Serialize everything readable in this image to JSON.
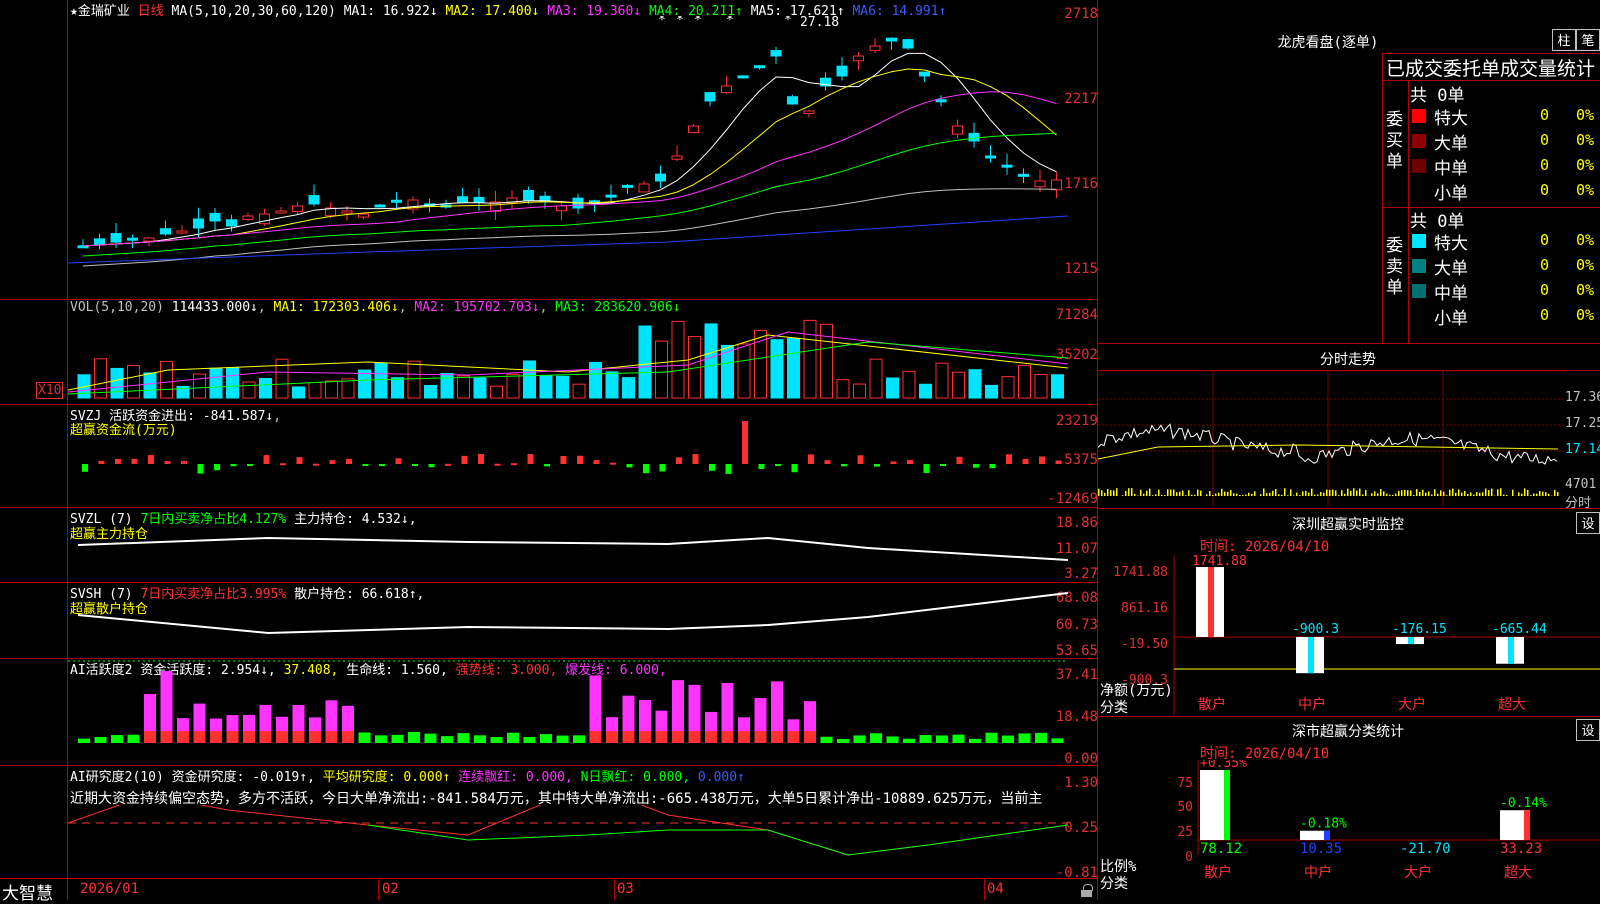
{
  "app": {
    "logo": "大智慧",
    "stock_name": "金瑞矿业",
    "period": "日线"
  },
  "kline": {
    "ma_header": "MA(5,10,20,30,60,120)",
    "ma1": "MA1: 16.922↓",
    "ma2": "MA2: 17.400↓",
    "ma3": "MA3: 19.360↓",
    "ma4": "MA4: 20.211↑",
    "ma5": "MA5: 17.621↑",
    "ma6": "MA6: 14.991↑",
    "y_labels": [
      "2718",
      "2217",
      "1716",
      "1215"
    ],
    "peak_label": "27.18",
    "stars": [
      "*",
      "*",
      "*",
      "*",
      "*"
    ]
  },
  "vol": {
    "header": "VOL(5,10,20)",
    "value": "114433.000↓",
    "ma1": "MA1: 172303.406↓",
    "ma2": "MA2: 195702.703↓",
    "ma3": "MA3: 283620.906↓",
    "y_labels": [
      "71284",
      "35202"
    ],
    "unit": "X10"
  },
  "svzj": {
    "header": "SVZJ",
    "title": "活跃资金进出: -841.587↓",
    "subtitle": "超赢资金流(万元)",
    "y_labels": [
      "23219",
      "5375",
      "-12469"
    ]
  },
  "svzl": {
    "header": "SVZL (7)",
    "desc": "7日内买卖净占比4.127%",
    "label": "主力持仓: 4.532↓,",
    "subtitle": "超赢主力持仓",
    "y_labels": [
      "18.86",
      "11.07",
      "3.27"
    ]
  },
  "svsh": {
    "header": "SVSH (7)",
    "desc": "7日内买卖净占比3.995%",
    "label": "散户持仓: 66.618↑,",
    "subtitle": "超赢散户持仓",
    "y_labels": [
      "68.08",
      "60.73",
      "53.65"
    ]
  },
  "ai1": {
    "header": "AI活跃度2",
    "a": "资金活跃度: 2.954↓,",
    "b": "37.408,",
    "c": "生命线: 1.560,",
    "d": "强势线: 3.000,",
    "e": "爆发线: 6.000,",
    "y_labels": [
      "37.41",
      "18.48",
      "0.00"
    ]
  },
  "ai2": {
    "header": "AI研究度2(10)",
    "a": "资金研究度: -0.019↑,",
    "b": "平均研究度: 0.000↑",
    "c": "连续飘红: 0.000,",
    "d": "N日飘红: 0.000,",
    "e": "0.000↑",
    "commentary": "近期大资金持续偏空态势，多方不活跃，今日大单净流出:-841.584万元，其中特大单净流出:-665.438万元，大单5日累计净出-10889.625万元，当前主",
    "y_labels": [
      "1.30",
      "0.25",
      "-0.81"
    ]
  },
  "xaxis": {
    "labels": [
      "2026/01",
      "02",
      "03",
      "04"
    ]
  },
  "dragon": {
    "title": "龙虎看盘(逐单)",
    "btn1": "柱",
    "btn2": "笔",
    "stats_title": "已成交委托单成交量统计",
    "buy_label": "委买单",
    "sell_label": "委卖单",
    "buy_total": "共 0单",
    "sell_total": "共 0单",
    "buy_rows": [
      {
        "name": "特大",
        "count": "0",
        "pct": "0%",
        "color": "#ff0000"
      },
      {
        "name": "大单",
        "count": "0",
        "pct": "0%",
        "color": "#900000"
      },
      {
        "name": "中单",
        "count": "0",
        "pct": "0%",
        "color": "#700000"
      },
      {
        "name": "小单",
        "count": "0",
        "pct": "0%",
        "color": ""
      }
    ],
    "sell_rows": [
      {
        "name": "特大",
        "count": "0",
        "pct": "0%",
        "color": "#00e5ff"
      },
      {
        "name": "大单",
        "count": "0",
        "pct": "0%",
        "color": "#008080"
      },
      {
        "name": "中单",
        "count": "0",
        "pct": "0%",
        "color": "#007070"
      },
      {
        "name": "小单",
        "count": "0",
        "pct": "0%",
        "color": ""
      }
    ]
  },
  "minute": {
    "title": "分时走势",
    "y_labels": [
      "17.36",
      "17.25",
      "17.14",
      "4701"
    ],
    "x_label": "分时"
  },
  "monitor": {
    "title": "深圳超赢实时监控",
    "btn": "设",
    "time": "时间: 2026/04/10",
    "y_labels": [
      "1741.88",
      "861.16",
      "-19.50",
      "-900.3"
    ],
    "axis_label": "净额(万元)",
    "cat_label": "分类",
    "bars": [
      {
        "cat": "散户",
        "value": 1741.88,
        "label": "1741.88"
      },
      {
        "cat": "中户",
        "value": -900.3,
        "label": "-900.3"
      },
      {
        "cat": "大户",
        "value": -176.15,
        "label": "-176.15"
      },
      {
        "cat": "超大",
        "value": -665.44,
        "label": "-665.44"
      }
    ]
  },
  "stats": {
    "title": "深市超赢分类统计",
    "btn": "设",
    "time": "时间: 2026/04/10",
    "y_labels": [
      "75",
      "50",
      "25",
      "0"
    ],
    "axis_label": "比例%",
    "cat_label": "分类",
    "bars": [
      {
        "cat": "散户",
        "pct_label": "+0.35%",
        "value": 78.12,
        "label": "78.12"
      },
      {
        "cat": "中户",
        "pct_label": "-0.18%",
        "value": 10.35,
        "label": "10.35"
      },
      {
        "cat": "大户",
        "pct_label": "",
        "value": -21.7,
        "label": "-21.70"
      },
      {
        "cat": "超大",
        "pct_label": "-0.14%",
        "value": 33.23,
        "label": "33.23"
      }
    ]
  }
}
